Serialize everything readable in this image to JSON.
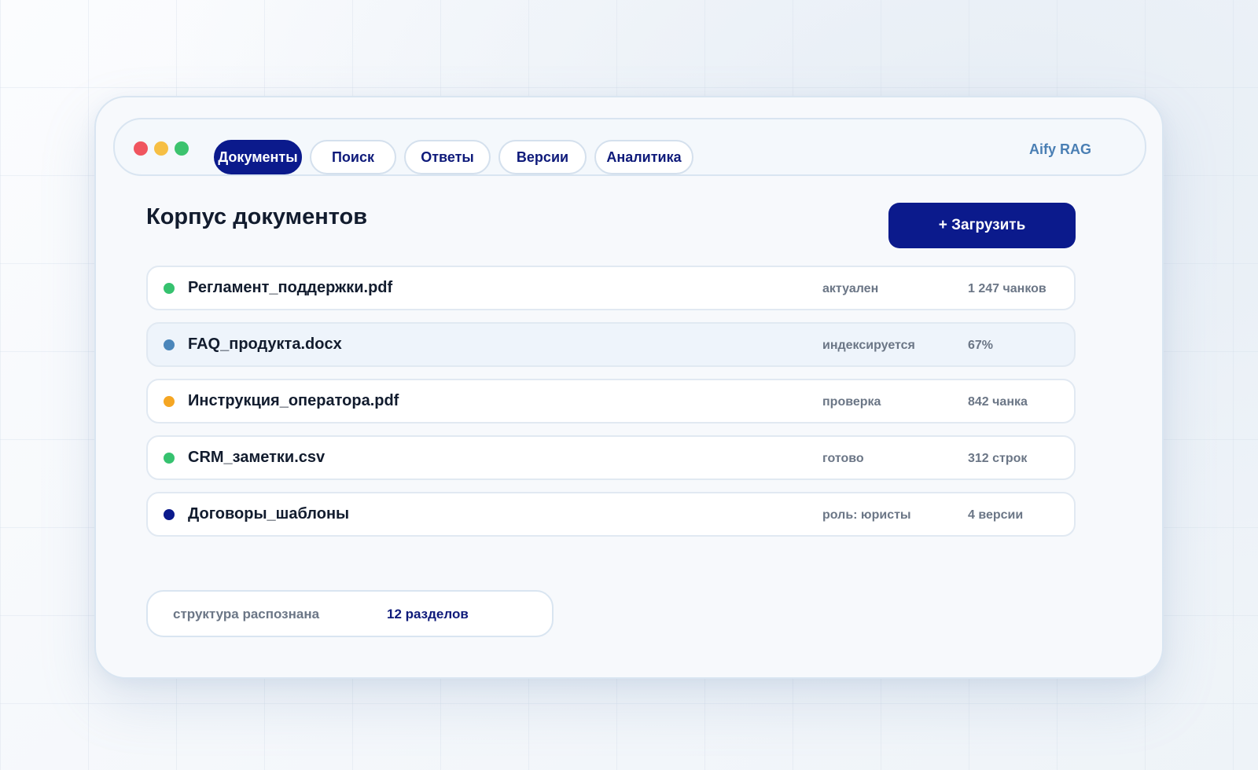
{
  "window": {
    "brand": "Aify RAG",
    "tabs": [
      {
        "label": "Документы",
        "active": true
      },
      {
        "label": "Поиск",
        "active": false
      },
      {
        "label": "Ответы",
        "active": false
      },
      {
        "label": "Версии",
        "active": false
      },
      {
        "label": "Аналитика",
        "active": false
      }
    ]
  },
  "main": {
    "title": "Корпус документов",
    "upload_label": "+ Загрузить",
    "documents": [
      {
        "name": "Регламент_поддержки.pdf",
        "status": "актуален",
        "meta": "1 247 чанков",
        "status_color": "#36c26f"
      },
      {
        "name": "FAQ_продукта.docx",
        "status": "индексируется",
        "meta": "67%",
        "status_color": "#4b86ba"
      },
      {
        "name": "Инструкция_оператора.pdf",
        "status": "проверка",
        "meta": "842 чанка",
        "status_color": "#f5a623"
      },
      {
        "name": "CRM_заметки.csv",
        "status": "готово",
        "meta": "312 строк",
        "status_color": "#36c26f"
      },
      {
        "name": "Договоры_шаблоны",
        "status": "роль: юристы",
        "meta": "4 версии",
        "status_color": "#0b1a8c"
      }
    ],
    "structure": {
      "label": "структура распознана",
      "value": "12 разделов"
    }
  },
  "colors": {
    "accent": "#0b1a8c",
    "brand_text": "#4a7fb4"
  }
}
